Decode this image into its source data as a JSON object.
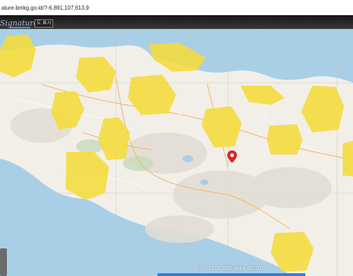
{
  "browser": {
    "url": "ature.bmkg.go.id/?-6.891,107.613,9"
  },
  "header": {
    "brand": "Signature",
    "badge": "도 표시"
  },
  "map": {
    "sea_color": "#a9cfe6",
    "land_color": "#f2efe9",
    "zone_color": "#f5dc3c",
    "pin_icon": "map-pin-icon",
    "pin_color": "#d7262b"
  },
  "footer": {
    "timestamp": "기기, 27 09 2021 pukul 00 UTC"
  }
}
